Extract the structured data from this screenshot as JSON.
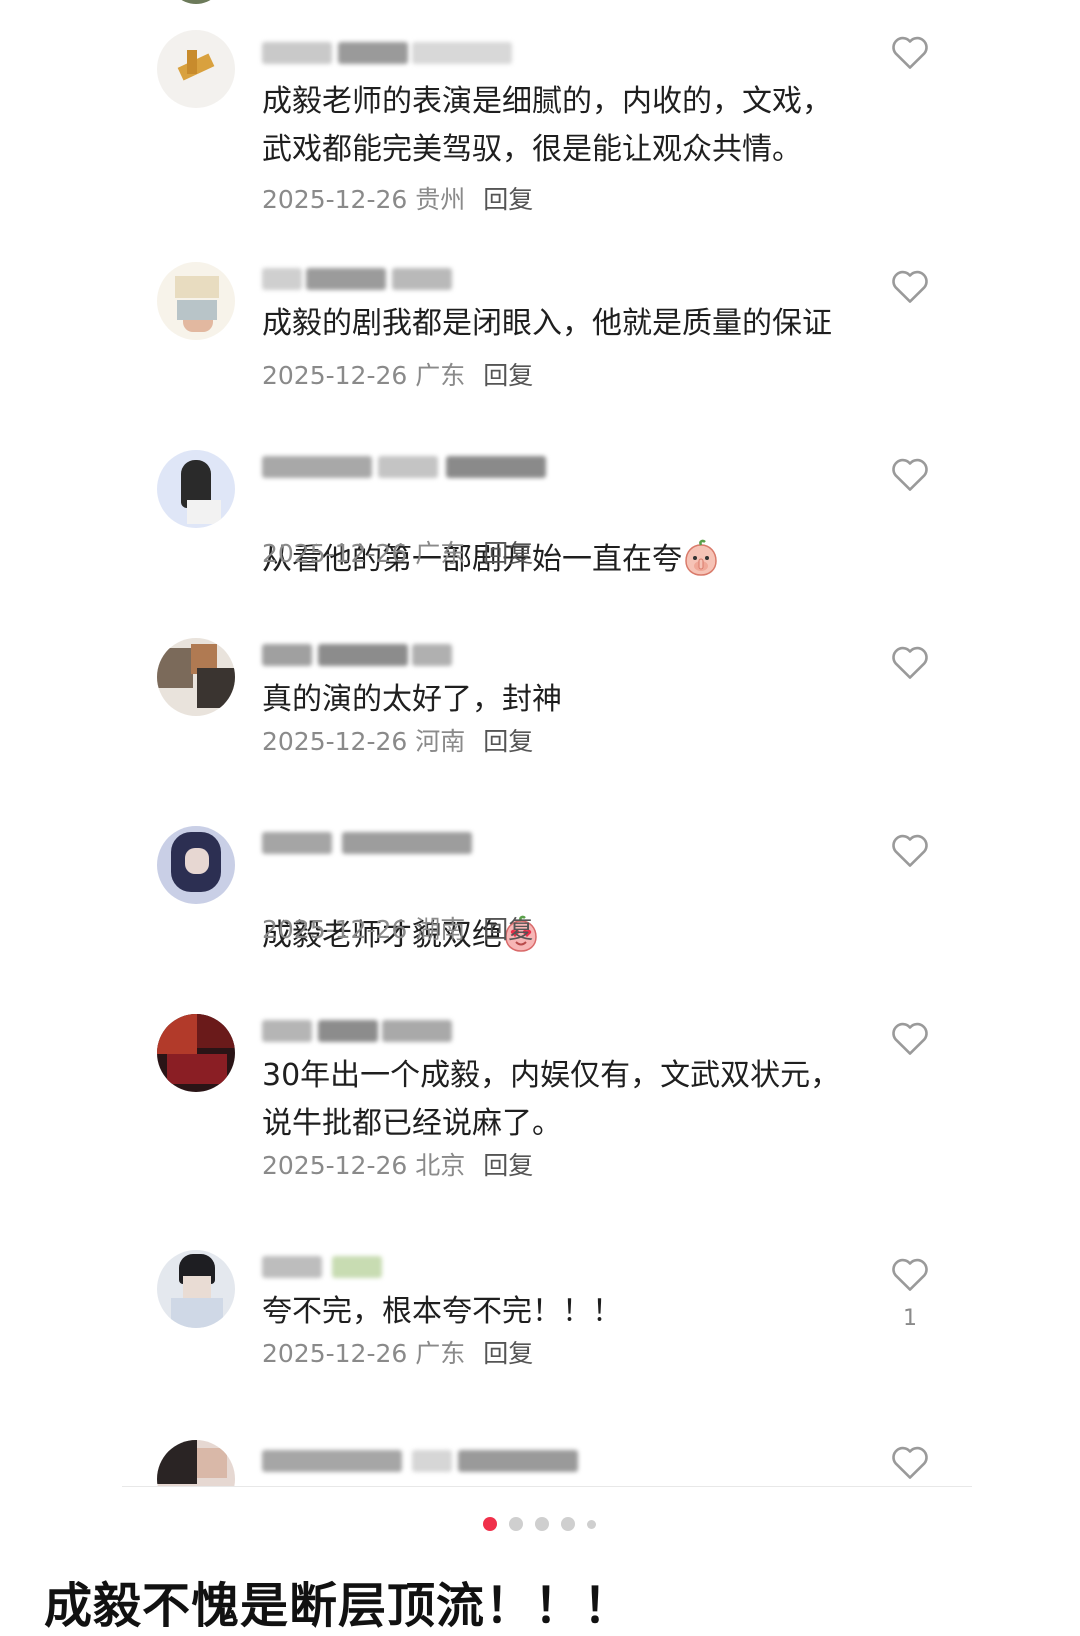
{
  "comments": [
    {
      "text": "成毅老师的表演是细腻的，内收的，文戏，\n武戏都能完美驾驭，很是能让观众共情。",
      "date": "2025-12-26",
      "region": "贵州",
      "reply_label": "回复",
      "like_count": ""
    },
    {
      "text": "成毅的剧我都是闭眼入，他就是质量的保证",
      "date": "2025-12-26",
      "region": "广东",
      "reply_label": "回复",
      "like_count": ""
    },
    {
      "text": "从看他的第一部剧开始一直在夸",
      "date": "2025-12-26",
      "region": "广东",
      "reply_label": "回复",
      "like_count": "",
      "emoji": "covering-mouth-peach-emoji"
    },
    {
      "text": "真的演的太好了，封神",
      "date": "2025-12-26",
      "region": "河南",
      "reply_label": "回复",
      "like_count": ""
    },
    {
      "text": "成毅老师才貌双绝",
      "date": "2025-12-26",
      "region": "湖南",
      "reply_label": "回复",
      "like_count": "",
      "emoji": "heart-eyes-peach-emoji"
    },
    {
      "text": "30年出一个成毅，内娱仅有，文武双状元，\n说牛批都已经说麻了。",
      "date": "2025-12-26",
      "region": "北京",
      "reply_label": "回复",
      "like_count": ""
    },
    {
      "text": "夸不完，根本夸不完！！！",
      "date": "2025-12-26",
      "region": "广东",
      "reply_label": "回复",
      "like_count": "1"
    }
  ],
  "pagination": {
    "total": 5,
    "active_index": 0
  },
  "caption": "成毅不愧是断层顶流！！！",
  "colors": {
    "accent": "#f0304a",
    "meta": "#8a8a8a",
    "heart_outline": "#9a9a9a"
  }
}
